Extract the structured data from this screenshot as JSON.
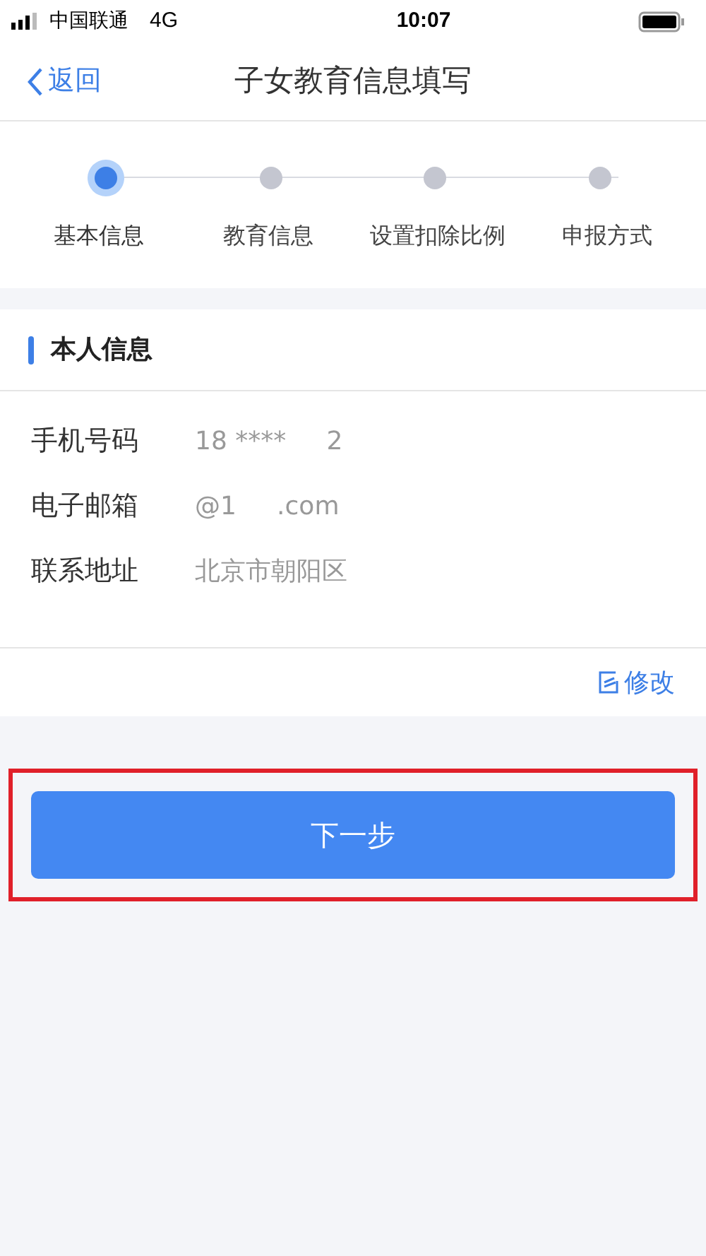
{
  "status_bar": {
    "carrier": "中国联通",
    "network": "4G",
    "time": "10:07"
  },
  "nav": {
    "back": "返回",
    "title": "子女教育信息填写"
  },
  "steps": [
    {
      "label": "基本信息",
      "selected": true
    },
    {
      "label": "教育信息",
      "selected": false
    },
    {
      "label": "设置扣除比例",
      "selected": false
    },
    {
      "label": "申报方式",
      "selected": false
    }
  ],
  "section": {
    "title": "本人信息"
  },
  "fields": [
    {
      "label": "手机号码",
      "value": "18 ****     2"
    },
    {
      "label": "电子邮箱",
      "value": "@1     .com"
    },
    {
      "label": "联系地址",
      "value": "北京市朝阳区"
    }
  ],
  "edit_link": "修改",
  "next_button": {
    "label": "下一步",
    "highlighted": true
  }
}
